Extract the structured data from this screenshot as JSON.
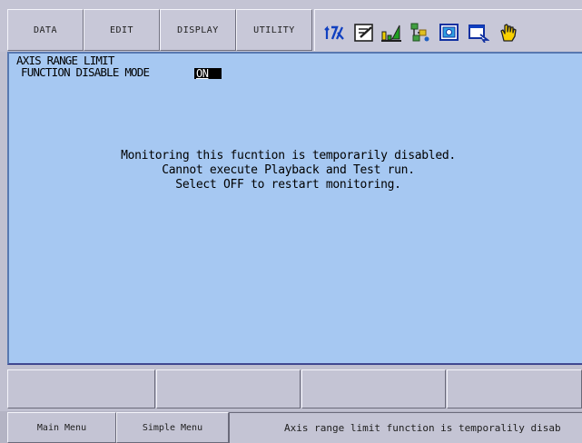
{
  "menu": {
    "items": [
      {
        "label": "DATA"
      },
      {
        "label": "EDIT"
      },
      {
        "label": "DISPLAY"
      },
      {
        "label": "UTILITY"
      }
    ]
  },
  "toolbar": {
    "icons": [
      "io-arrows-icon",
      "edit-check-icon",
      "signal-bars-icon",
      "network-icon",
      "monitor-icon",
      "window-arrow-icon",
      "hand-icon"
    ]
  },
  "panel": {
    "title": "AXIS RANGE LIMIT",
    "mode_label": "FUNCTION DISABLE MODE",
    "mode_value": "ON",
    "message_lines": [
      "Monitoring this fucntion is temporarily disabled.",
      "Cannot execute Playback and Test run.",
      "Select OFF to restart monitoring."
    ]
  },
  "footer": {
    "main_menu": "Main Menu",
    "simple_menu": "Simple Menu",
    "status": "Axis range limit function is temporalily disab"
  },
  "colors": {
    "panel_bg": "#a6c8f2",
    "chrome": "#c4c4d4",
    "value_bg": "#000000"
  }
}
